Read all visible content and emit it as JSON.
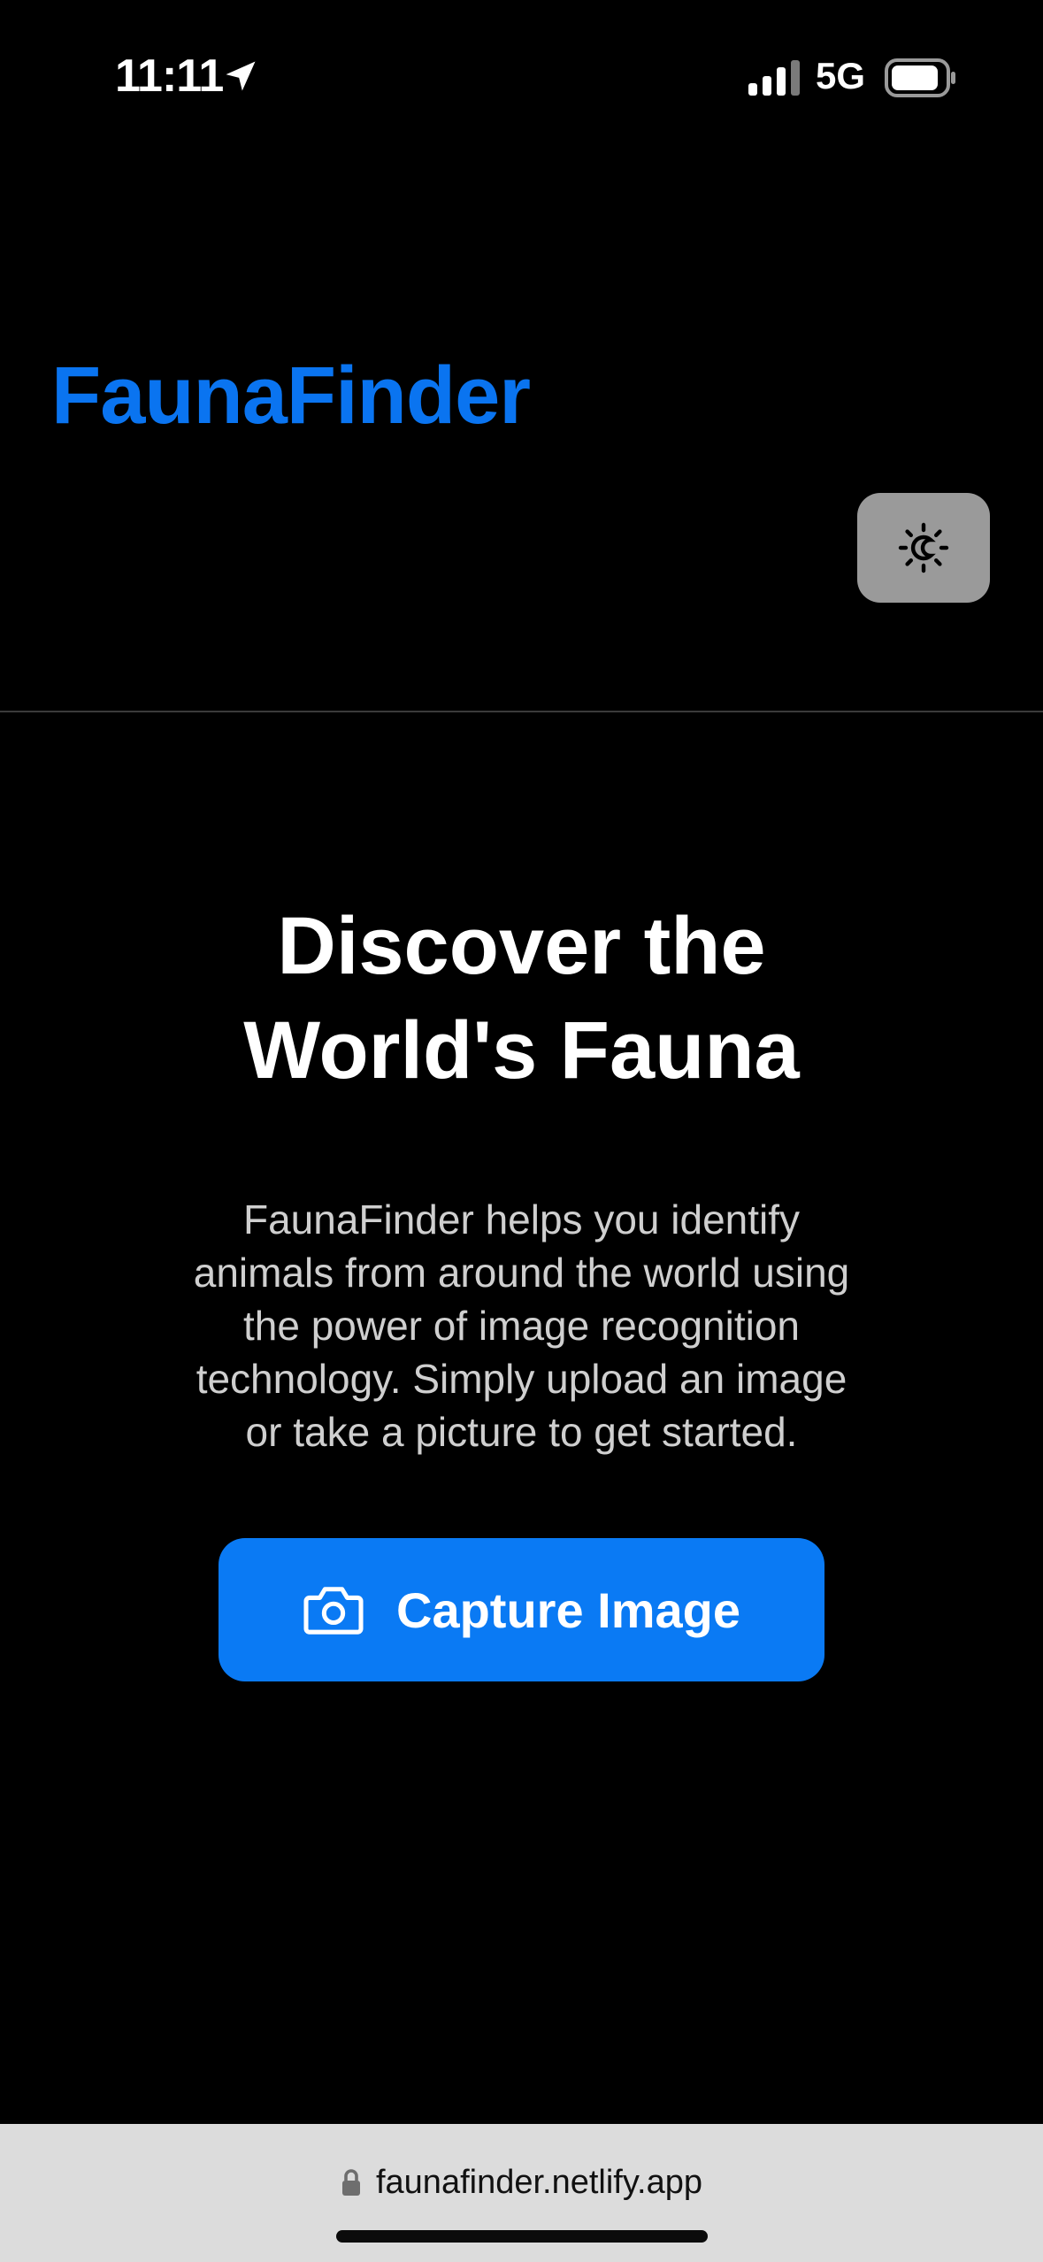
{
  "status_bar": {
    "time": "11:11",
    "network": "5G",
    "icons": [
      "location-arrow-icon",
      "cellular-signal-icon",
      "battery-icon"
    ]
  },
  "header": {
    "brand": "FaunaFinder",
    "theme_toggle_icon": "sun-moon-icon"
  },
  "hero": {
    "title_lines": [
      "Discover the",
      "World's Fauna"
    ],
    "description_lines": [
      "FaunaFinder helps you identify",
      "animals from around the world using",
      "the power of image recognition",
      "technology. Simply upload an image",
      "or take a picture to get started."
    ],
    "cta_label": "Capture Image",
    "cta_icon": "camera-icon"
  },
  "browser": {
    "url": "faunafinder.netlify.app",
    "icons": [
      "lock-icon"
    ]
  },
  "colors": {
    "background": "#000000",
    "brand": "#0a74f0",
    "cta": "#0a7af4",
    "toggle": "#9a9a9a",
    "browser_bar": "#dcdcdc"
  }
}
